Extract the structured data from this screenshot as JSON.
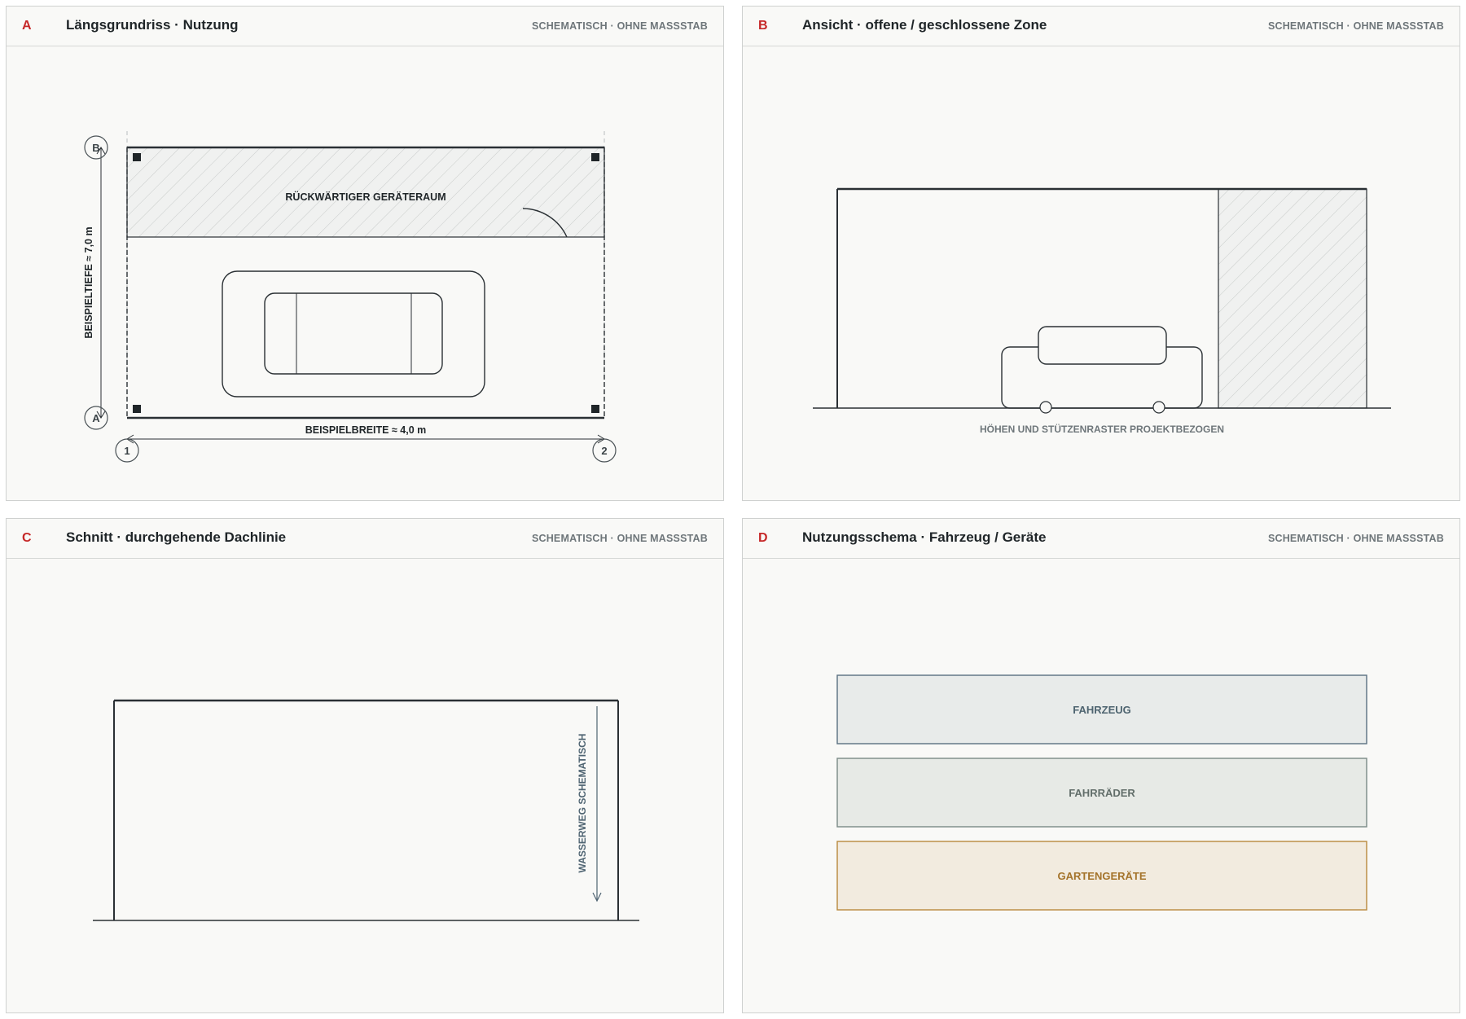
{
  "panels": [
    {
      "letter": "A",
      "title": "Längsgrundriss · Nutzung",
      "note": "SCHEMATISCH · OHNE MASSSTAB",
      "room_label": "RÜCKWÄRTIGER GERÄTERAUM",
      "dim_depth": "BEISPIELTIEFE ≈ 7,0 m",
      "dim_width": "BEISPIELBREITE ≈ 4,0 m",
      "grid_1": "1",
      "grid_2": "2",
      "grid_a": "A",
      "grid_b": "B"
    },
    {
      "letter": "B",
      "title": "Ansicht · offene / geschlossene Zone",
      "note": "SCHEMATISCH · OHNE MASSSTAB",
      "caption": "HÖHEN UND STÜTZENRASTER PROJEKTBEZOGEN"
    },
    {
      "letter": "C",
      "title": "Schnitt · durchgehende Dachlinie",
      "note": "SCHEMATISCH · OHNE MASSSTAB",
      "water_label": "WASSERWEG SCHEMATISCH"
    },
    {
      "letter": "D",
      "title": "Nutzungsschema · Fahrzeug / Geräte",
      "note": "SCHEMATISCH · OHNE MASSSTAB",
      "zones": [
        {
          "label": "FAHRZEUG",
          "fill": "#e8ebea",
          "stroke": "#5a7080",
          "text": "#4e6470"
        },
        {
          "label": "FAHRRÄDER",
          "fill": "#e7eae6",
          "stroke": "#7a8a86",
          "text": "#626e6a"
        },
        {
          "label": "GARTENGERÄTE",
          "fill": "#f2ebdf",
          "stroke": "#b8893c",
          "text": "#a4732a"
        }
      ]
    }
  ],
  "colors": {
    "accent": "#c62828",
    "line": "#2a3034",
    "hatch_fill": "#f0f1f0",
    "hatch": "#c8cbca"
  }
}
